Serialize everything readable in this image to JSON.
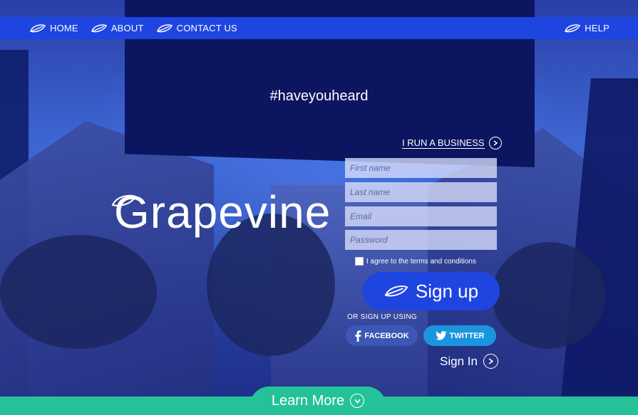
{
  "nav": {
    "left_items": [
      {
        "label": "HOME"
      },
      {
        "label": "ABOUT"
      },
      {
        "label": "CONTACT US"
      }
    ],
    "right_items": [
      {
        "label": "HELP"
      }
    ]
  },
  "hero": {
    "hashtag": "#haveyouheard",
    "logo_text": "Grapevine"
  },
  "form": {
    "business_link": "I RUN A BUSINESS",
    "first_name_placeholder": "First name",
    "last_name_placeholder": "Last name",
    "email_placeholder": "Email",
    "password_placeholder": "Password",
    "agree_label": "I agree to the terms and conditions",
    "signup_label": "Sign up",
    "or_label": "OR SIGN UP USING",
    "facebook_label": "FACEBOOK",
    "twitter_label": "TWITTER",
    "signin_label": "Sign In"
  },
  "footer": {
    "learn_more_label": "Learn More"
  },
  "colors": {
    "nav_bg": "#1f45e0",
    "signup_bg": "#1f45e0",
    "facebook_bg": "#3c57b5",
    "twitter_bg": "#1b95e0",
    "footer_bg": "#25c29a"
  }
}
